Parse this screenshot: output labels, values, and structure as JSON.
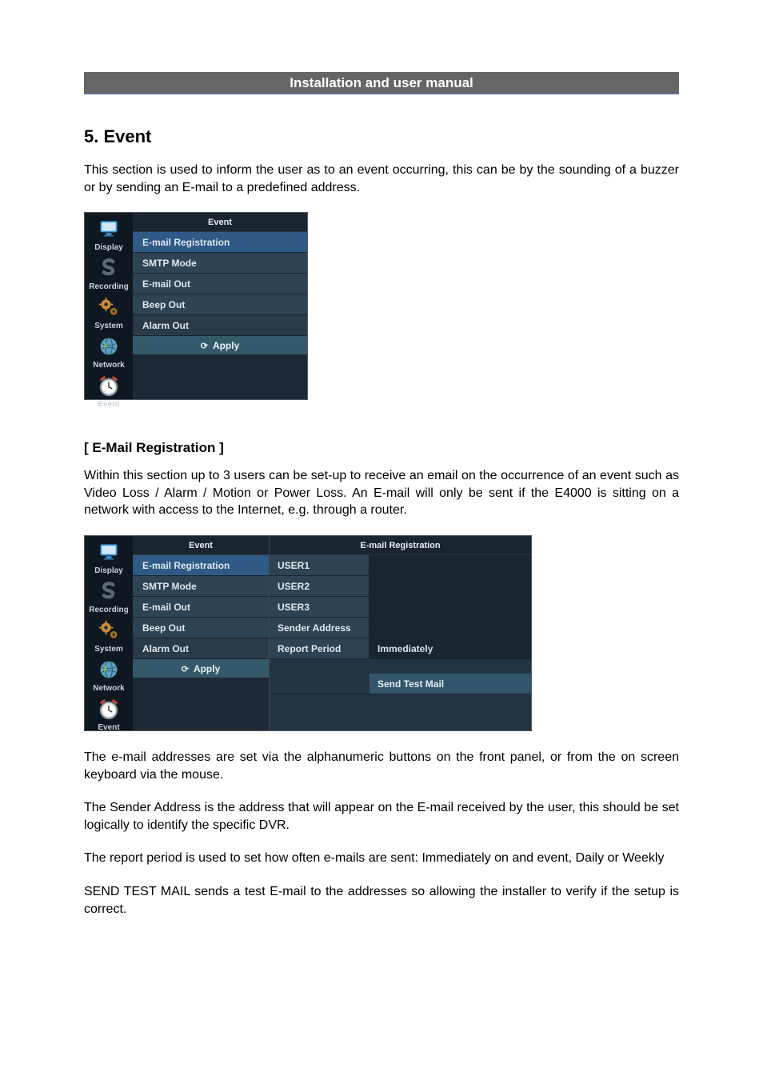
{
  "header": {
    "title": "Installation and user manual"
  },
  "section": {
    "title": "5. Event",
    "intro": "This section is used to inform the user as to an event occurring, this can be by the sounding of a buzzer or by sending an E-mail to a predefined address."
  },
  "menu": {
    "header": "Event",
    "items": [
      {
        "label": "E-mail Registration",
        "selected": true
      },
      {
        "label": "SMTP Mode"
      },
      {
        "label": "E-mail Out"
      },
      {
        "label": "Beep Out"
      },
      {
        "label": "Alarm Out",
        "alarm": true
      }
    ],
    "apply": "Apply"
  },
  "sidebar": {
    "items": [
      {
        "label": "Display",
        "name": "sidebar-item-display",
        "icon": "monitor-icon"
      },
      {
        "label": "Recording",
        "name": "sidebar-item-recording",
        "icon": "s-icon"
      },
      {
        "label": "System",
        "name": "sidebar-item-system",
        "icon": "gears-icon"
      },
      {
        "label": "Network",
        "name": "sidebar-item-network",
        "icon": "globe-icon"
      },
      {
        "label": "Event",
        "name": "sidebar-item-event",
        "icon": "clock-icon"
      }
    ]
  },
  "email_reg": {
    "heading": "[ E-Mail Registration ]",
    "desc": "Within this section up to 3 users can be set-up to receive an email on the occurrence of an event such as Video Loss / Alarm / Motion or Power Loss. An E-mail will only be sent if the E4000 is sitting on a network with access to the Internet, e.g. through a router.",
    "panel_header": "E-mail Registration",
    "rows": {
      "user1": "USER1",
      "user2": "USER2",
      "user3": "USER3",
      "sender": "Sender Address",
      "report": "Report Period",
      "report_val": "Immediately",
      "send_test": "Send Test Mail"
    },
    "p1": "The e-mail addresses are set via the alphanumeric buttons on the front panel, or from the on screen keyboard via the mouse.",
    "p2": "The Sender Address is the address that will appear on the E-mail received by the user, this should be set logically to identify the specific DVR.",
    "p3": "The report period is used to set how often e-mails are sent: Immediately on and event, Daily or Weekly",
    "p4": "SEND TEST MAIL sends a test E-mail to the addresses so allowing the installer to verify if the setup is correct."
  },
  "icons": {
    "monitor_color": "#3a96d8",
    "gears_color": "#b57628",
    "globe_color": "#5aa0c0",
    "clock_color": "#b8bdc3"
  }
}
